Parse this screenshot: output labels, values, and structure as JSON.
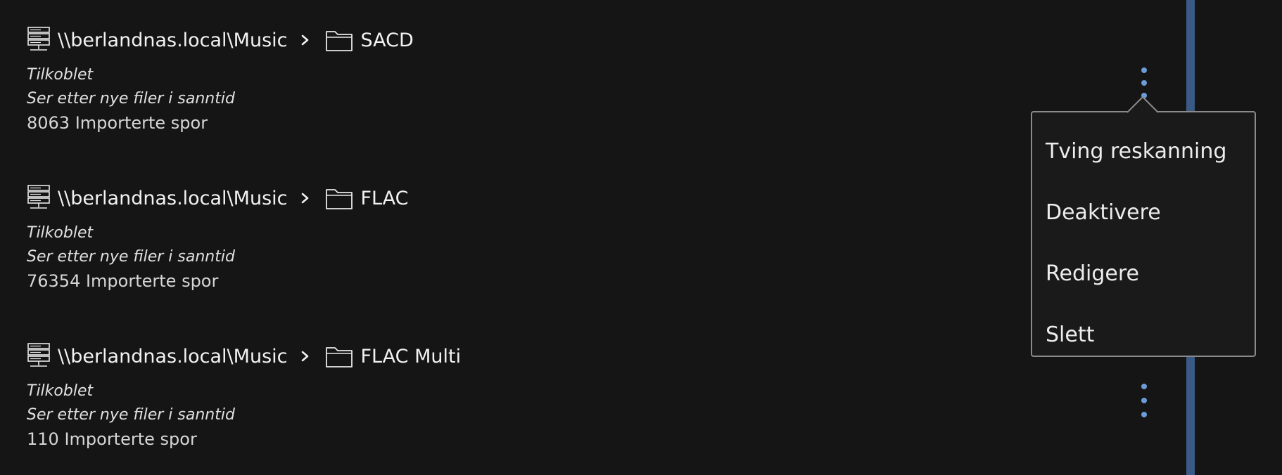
{
  "folders": [
    {
      "server": "\\\\berlandnas.local\\Music",
      "folder": "SACD",
      "status1": "Tilkoblet",
      "status2": "Ser etter nye filer i sanntid",
      "count": "8063 Importerte spor"
    },
    {
      "server": "\\\\berlandnas.local\\Music",
      "folder": "FLAC",
      "status1": "Tilkoblet",
      "status2": "Ser etter nye filer i sanntid",
      "count": "76354 Importerte spor"
    },
    {
      "server": "\\\\berlandnas.local\\Music",
      "folder": "FLAC Multi",
      "status1": "Tilkoblet",
      "status2": "Ser etter nye filer i sanntid",
      "count": "110 Importerte spor"
    }
  ],
  "menu": {
    "items": [
      "Tving reskanning",
      "Deaktivere",
      "Redigere",
      "Slett"
    ]
  },
  "colors": {
    "background": "#151515",
    "accent": "#6c9bd6",
    "scrollbar": "#3a5a86",
    "menu_border": "#8a8a8a"
  },
  "icons": {
    "server": "server-icon",
    "separator": "chevron-right-icon",
    "folder": "folder-icon",
    "more": "more-vertical-icon"
  }
}
